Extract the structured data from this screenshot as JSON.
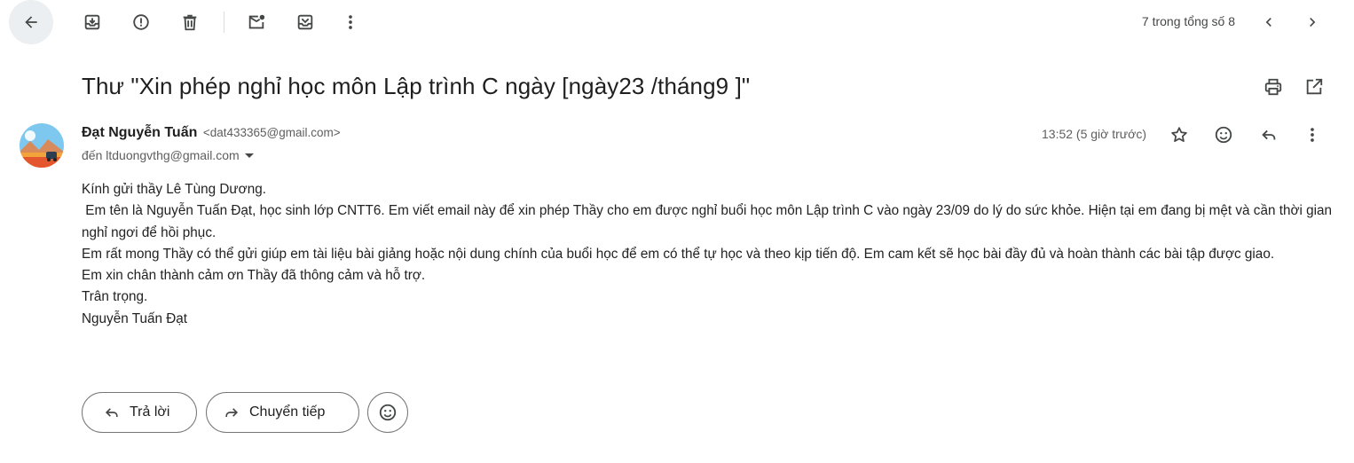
{
  "toolbar": {
    "back_icon": "arrow-left-icon",
    "actions": [
      {
        "name": "archive-icon"
      },
      {
        "name": "report-spam-icon"
      },
      {
        "name": "delete-icon"
      },
      {
        "name": "mark-unread-icon"
      },
      {
        "name": "move-to-icon"
      },
      {
        "name": "more-vert-icon"
      }
    ],
    "pager_text": "7 trong tổng số 8",
    "prev_icon": "chevron-left-icon",
    "next_icon": "chevron-right-icon"
  },
  "subject": {
    "title": "Thư \"Xin phép nghỉ học môn Lập trình C ngày [ngày23 /tháng9 ]\"",
    "print_icon": "print-icon",
    "open_new_window_icon": "open-in-new-icon"
  },
  "message": {
    "sender_name": "Đạt Nguyễn Tuấn",
    "sender_email": "<dat433365@gmail.com>",
    "recipient": "đến ltduongvthg@gmail.com",
    "time": "13:52 (5 giờ trước)",
    "body": [
      "Kính gửi thầy Lê Tùng Dương.",
      " Em tên là Nguyễn Tuấn Đạt, học sinh lớp CNTT6. Em viết email này để xin phép Thầy cho em được nghỉ buổi học môn Lập trình C vào ngày 23/09 do lý do sức khỏe. Hiện tại em đang bị mệt và cần thời gian nghỉ ngơi để hồi phục.",
      "Em rất mong Thầy có thể gửi giúp em tài liệu bài giảng hoặc nội dung chính của buổi học để em có thể tự học và theo kịp tiến độ. Em cam kết sẽ học bài đầy đủ và hoàn thành các bài tập được giao.",
      "Em xin chân thành cảm ơn Thầy đã thông cảm và hỗ trợ.",
      "Trân trọng.",
      "Nguyễn Tuấn Đạt"
    ]
  },
  "actions": {
    "reply_label": "Trả lời",
    "forward_label": "Chuyển tiếp"
  },
  "colors": {
    "text": "#1f1f1f",
    "secondary_text": "#5e5e5e",
    "icon": "#444746",
    "border": "#747775",
    "back_button_bg": "#eceff1"
  }
}
